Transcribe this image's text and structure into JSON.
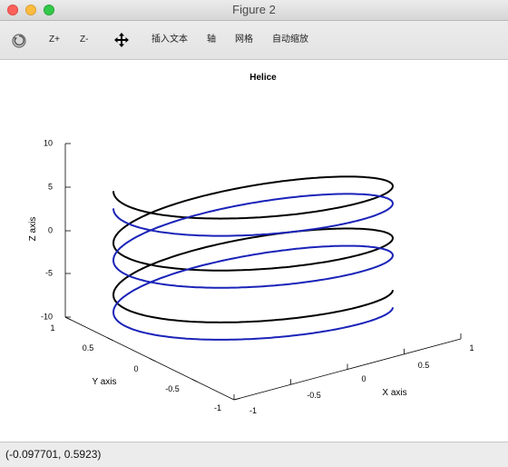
{
  "window": {
    "title": "Figure 2"
  },
  "toolbar": {
    "zoom_in_label": "Z+",
    "zoom_out_label": "Z-",
    "insert_text_label": "插入文本",
    "axis_label": "轴",
    "grid_label": "网格",
    "autoscale_label": "自动缩放",
    "rotate_icon": "rotate-icon",
    "pan_icon": "pan-arrows-icon"
  },
  "status": {
    "coordinates": "(-0.097701, 0.5923)"
  },
  "chart_data": {
    "type": "line",
    "title": "Helice",
    "xlabel": "X axis",
    "ylabel": "Y axis",
    "zlabel": "Z axis",
    "xlim": [
      -1,
      1
    ],
    "ylim": [
      -1,
      1
    ],
    "zlim": [
      -10,
      10
    ],
    "x_ticks": [
      "-1",
      "-0.5",
      "0",
      "0.5",
      "1"
    ],
    "y_ticks": [
      "-1",
      "-0.5",
      "0",
      "0.5",
      "1"
    ],
    "z_ticks": [
      "-10",
      "-5",
      "0",
      "5",
      "10"
    ],
    "grid": false,
    "series": [
      {
        "color": "#000000",
        "x": "cos(t)",
        "y": "sin(t)",
        "z_range": [
          -8,
          7
        ],
        "turns": 2.5
      },
      {
        "color": "#1a23b8",
        "x": "cos(t)",
        "y": "sin(t)",
        "z_range": [
          -10,
          5
        ],
        "turns": 2.5
      }
    ]
  }
}
